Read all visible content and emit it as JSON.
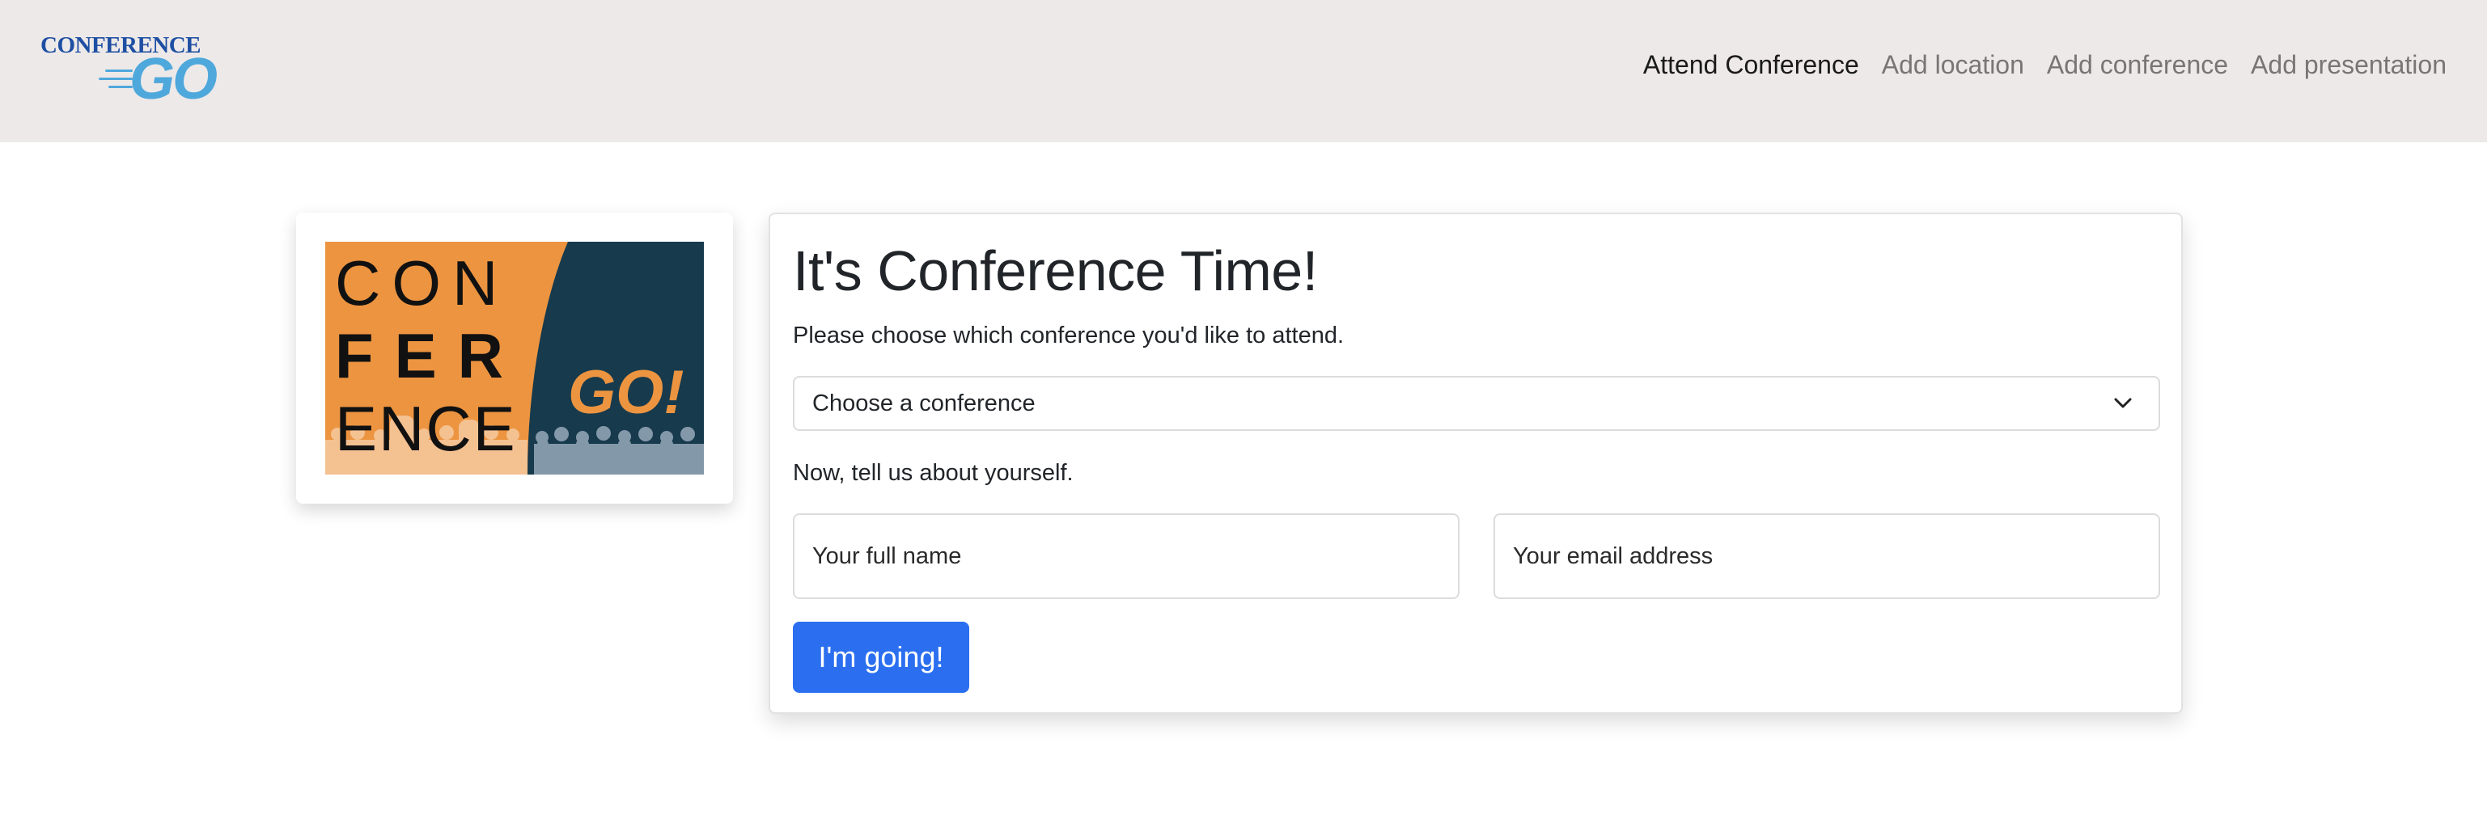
{
  "navbar": {
    "brand": {
      "top_text": "CONFERENCE",
      "bottom_text": "GO"
    },
    "links": [
      {
        "label": "Attend Conference",
        "active": true
      },
      {
        "label": "Add location",
        "active": false
      },
      {
        "label": "Add conference",
        "active": false
      },
      {
        "label": "Add presentation",
        "active": false
      }
    ]
  },
  "logo_card": {
    "line1": "CON",
    "line2": "FER",
    "line3": "ENCE",
    "go": "GO!",
    "colors": {
      "orange": "#ec9440",
      "navy": "#173a4d"
    }
  },
  "form": {
    "title": "It's Conference Time!",
    "subtitle": "Please choose which conference you'd like to attend.",
    "select": {
      "selected": "Choose a conference"
    },
    "about_text": "Now, tell us about yourself.",
    "name_placeholder": "Your full name",
    "email_placeholder": "Your email address",
    "submit_label": "I'm going!"
  },
  "colors": {
    "navbar_bg": "#ede9e8",
    "primary": "#2b6ff0",
    "brand_blue": "#4fa8dc"
  }
}
